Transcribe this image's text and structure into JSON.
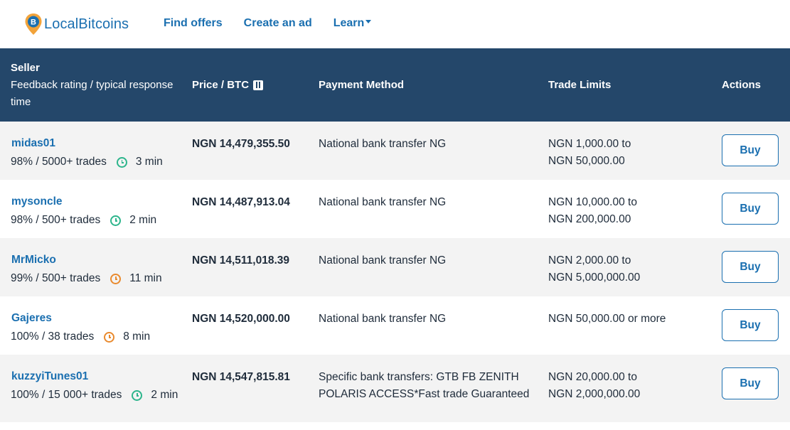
{
  "header": {
    "logo_text": "LocalBitcoins",
    "nav": {
      "find_offers": "Find offers",
      "create_ad": "Create an ad",
      "learn": "Learn"
    }
  },
  "table": {
    "columns": {
      "seller": "Seller",
      "seller_sub": "Feedback rating / typical response time",
      "price": "Price / BTC",
      "payment": "Payment Method",
      "limits": "Trade Limits",
      "actions": "Actions"
    },
    "rows": [
      {
        "name": "midas01",
        "stats": "98% / 5000+ trades",
        "time": "3 min",
        "clock": "green",
        "price": "NGN 14,479,355.50",
        "payment": "National bank transfer NG",
        "limit1": "NGN 1,000.00 to",
        "limit2": "NGN 50,000.00",
        "action": "Buy"
      },
      {
        "name": "mysoncle",
        "stats": "98% / 500+ trades",
        "time": "2 min",
        "clock": "green",
        "price": "NGN 14,487,913.04",
        "payment": "National bank transfer NG",
        "limit1": "NGN 10,000.00 to",
        "limit2": "NGN 200,000.00",
        "action": "Buy"
      },
      {
        "name": "MrMicko",
        "stats": "99% / 500+ trades",
        "time": "11 min",
        "clock": "orange",
        "price": "NGN 14,511,018.39",
        "payment": "National bank transfer NG",
        "limit1": "NGN 2,000.00 to",
        "limit2": "NGN 5,000,000.00",
        "action": "Buy"
      },
      {
        "name": "Gajeres",
        "stats": "100% / 38 trades",
        "time": "8 min",
        "clock": "orange",
        "price": "NGN 14,520,000.00",
        "payment": "National bank transfer NG",
        "limit1": "NGN 50,000.00 or more",
        "limit2": "",
        "action": "Buy"
      },
      {
        "name": "kuzzyiTunes01",
        "stats": "100% / 15 000+ trades",
        "time": "2 min",
        "clock": "green",
        "price": "NGN 14,547,815.81",
        "payment": "Specific bank transfers: GTB FB ZENITH POLARIS ACCESS*Fast trade Guaranteed",
        "limit1": "NGN 20,000.00 to",
        "limit2": "NGN 2,000,000.00",
        "action": "Buy"
      }
    ]
  },
  "colors": {
    "header_bg": "#24476a",
    "link": "#1a6fb0",
    "clock_green": "#2db58c",
    "clock_orange": "#e98a2e"
  }
}
